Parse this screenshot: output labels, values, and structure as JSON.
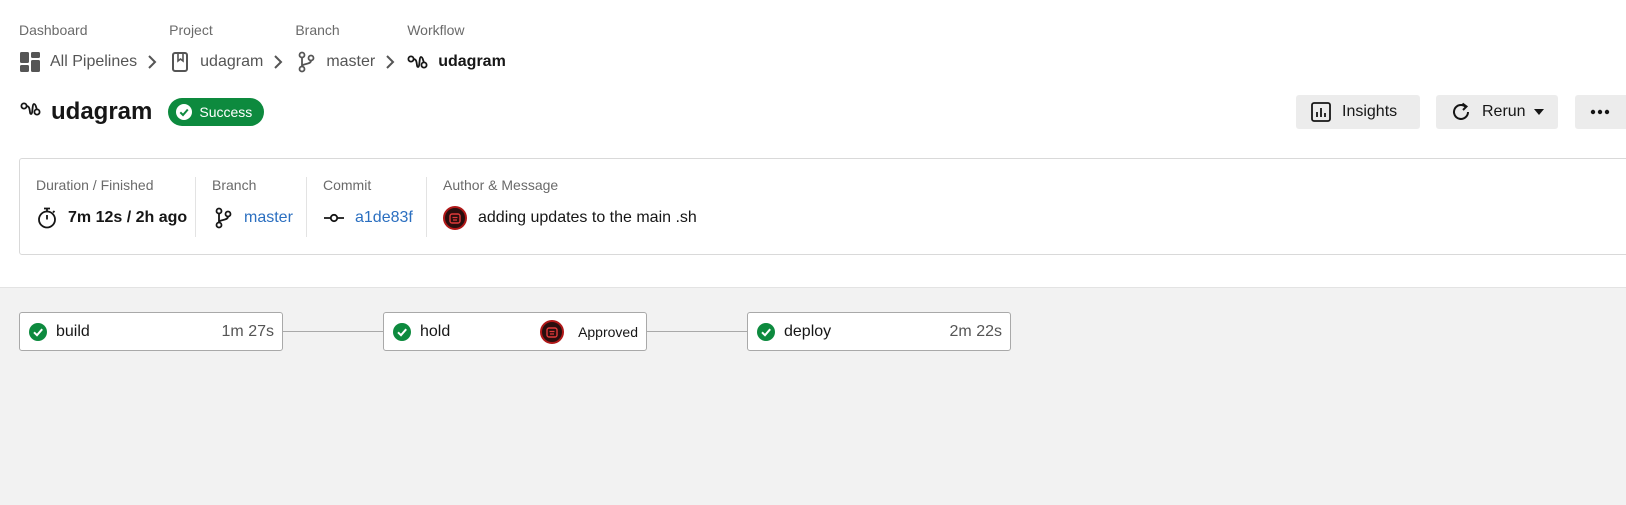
{
  "breadcrumb": [
    {
      "label": "Dashboard",
      "text": "All Pipelines",
      "icon": "dashboard-icon"
    },
    {
      "label": "Project",
      "text": "udagram",
      "icon": "project-icon"
    },
    {
      "label": "Branch",
      "text": "master",
      "icon": "branch-icon"
    },
    {
      "label": "Workflow",
      "text": "udagram",
      "icon": "workflow-icon"
    }
  ],
  "header": {
    "title": "udagram",
    "status": "Success",
    "status_color": "#0d8a3e",
    "insights_label": "Insights",
    "rerun_label": "Rerun",
    "more_label": "..."
  },
  "summary": {
    "duration_label": "Duration / Finished",
    "duration_value": "7m 12s / 2h ago",
    "branch_label": "Branch",
    "branch_value": "master",
    "commit_label": "Commit",
    "commit_value": "a1de83f",
    "author_label": "Author & Message",
    "message": "adding updates to the main .sh",
    "link_color": "#2b6fc0"
  },
  "jobs": [
    {
      "name": "build",
      "duration": "1m 27s",
      "status": "success"
    },
    {
      "name": "hold",
      "approval": "Approved",
      "status": "success"
    },
    {
      "name": "deploy",
      "duration": "2m 22s",
      "status": "success"
    }
  ]
}
